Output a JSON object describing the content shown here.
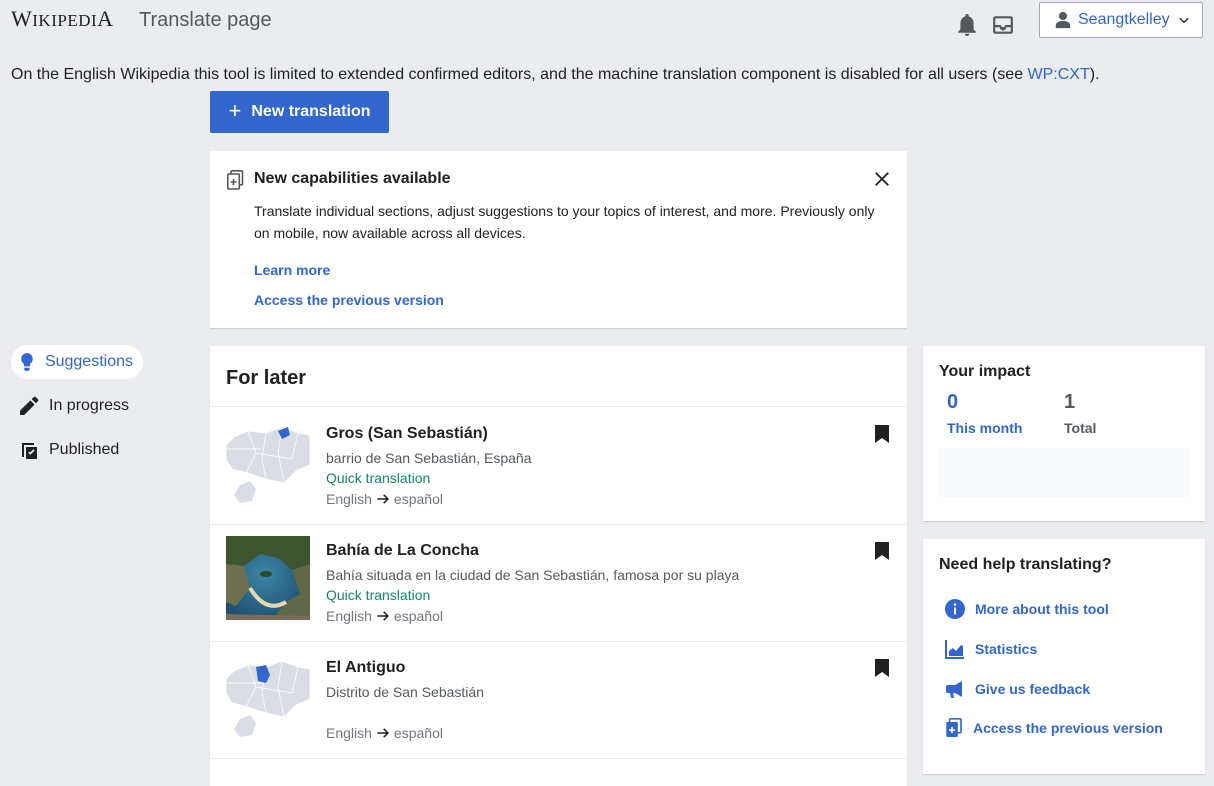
{
  "header": {
    "logo_first": "W",
    "logo_rest": "IKIPEDI",
    "logo_last": "A",
    "title": "Translate page",
    "user": "Seangtkelley"
  },
  "notice": {
    "text": "On the English Wikipedia this tool is limited to extended confirmed editors, and the machine translation component is disabled for all users (see ",
    "link": "WP:CXT",
    "tail": ")."
  },
  "new_translation": {
    "plus": "+",
    "label": "New translation"
  },
  "capabilities": {
    "title": "New capabilities available",
    "description": "Translate individual sections, adjust suggestions to your topics of interest, and more. Previously only on mobile, now available across all devices.",
    "learn_more": "Learn more",
    "previous_version": "Access the previous version"
  },
  "nav": {
    "suggestions": "Suggestions",
    "in_progress": "In progress",
    "published": "Published"
  },
  "for_later": {
    "title": "For later",
    "items": [
      {
        "name": "Gros (San Sebastián)",
        "description": "barrio de San Sebastián, España",
        "tag": "Quick translation",
        "source": "English",
        "target": "español",
        "thumb": "map"
      },
      {
        "name": "Bahía de La Concha",
        "description": "Bahía situada en la ciudad de San Sebastián, famosa por su playa",
        "tag": "Quick translation",
        "source": "English",
        "target": "español",
        "thumb": "photo"
      },
      {
        "name": "El Antiguo",
        "description": "Distrito de San Sebastián",
        "tag": "",
        "source": "English",
        "target": "español",
        "thumb": "map"
      }
    ]
  },
  "impact": {
    "title": "Your impact",
    "this_month_value": "0",
    "this_month_label": "This month",
    "total_value": "1",
    "total_label": "Total"
  },
  "help": {
    "title": "Need help translating?",
    "items": [
      {
        "label": "More about this tool",
        "icon": "info-icon"
      },
      {
        "label": "Statistics",
        "icon": "chart-icon"
      },
      {
        "label": "Give us feedback",
        "icon": "megaphone-icon"
      },
      {
        "label": "Access the previous version",
        "icon": "previous-version-icon"
      }
    ]
  },
  "colors": {
    "accent": "#3366cc",
    "quick_translation": "#14866d",
    "background": "#eaecf0"
  }
}
